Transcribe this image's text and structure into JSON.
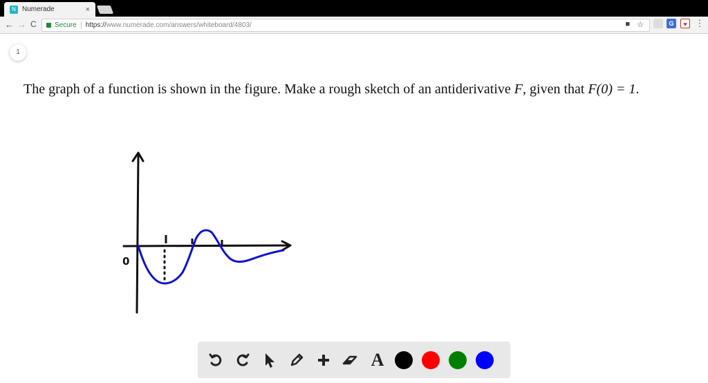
{
  "browser": {
    "tab_title": "Numerade",
    "tab_close": "×",
    "favicon_text": "N",
    "security_label": "Secure",
    "url_scheme": "https://",
    "url_rest": "www.numerade.com/answers/whiteboard/4803/",
    "nav_back": "←",
    "nav_forward": "→",
    "nav_reload": "C"
  },
  "page": {
    "page_number": "1",
    "question_prefix": "The graph of a function is shown in the figure. Make a rough sketch of an antiderivative ",
    "question_var": "F",
    "question_mid": ", given that ",
    "question_math": "F(0) = 1",
    "question_end": "."
  },
  "sketch": {
    "origin_label": "0",
    "curve_color": "#1010d0",
    "axis_color": "#111111"
  },
  "palette": {
    "tools": [
      "undo-icon",
      "redo-icon",
      "pointer-icon",
      "pencil-icon",
      "plus-icon",
      "eraser-icon",
      "text-tool-icon"
    ],
    "text_tool_label": "A",
    "colors": [
      "#000000",
      "#ff0000",
      "#008000",
      "#0000ff"
    ]
  }
}
